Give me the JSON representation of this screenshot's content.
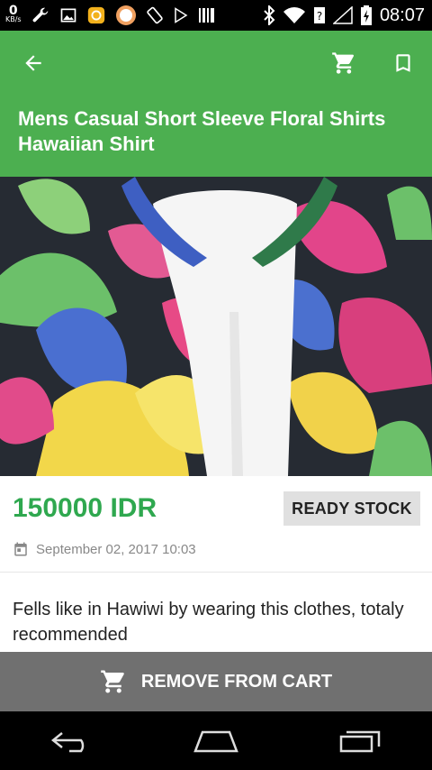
{
  "status_bar": {
    "net_speed_value": "0",
    "net_speed_unit": "KB/s",
    "time": "08:07"
  },
  "app_bar": {
    "title": "Mens Casual Short Sleeve Floral Shirts Hawaiian Shirt",
    "icons": [
      "arrow-back-icon",
      "cart-icon",
      "bookmark-icon"
    ]
  },
  "product": {
    "price": "150000 IDR",
    "stock_badge": "READY STOCK",
    "date": "September 02, 2017 10:03",
    "description": "Fells like in Hawiwi by wearing this clothes, totaly recommended"
  },
  "cart_action": {
    "label": "REMOVE FROM CART"
  },
  "colors": {
    "app_bar": "#4caf50",
    "price": "#2fa84f",
    "cart_bar": "#707070",
    "badge": "#e0e0e0"
  }
}
